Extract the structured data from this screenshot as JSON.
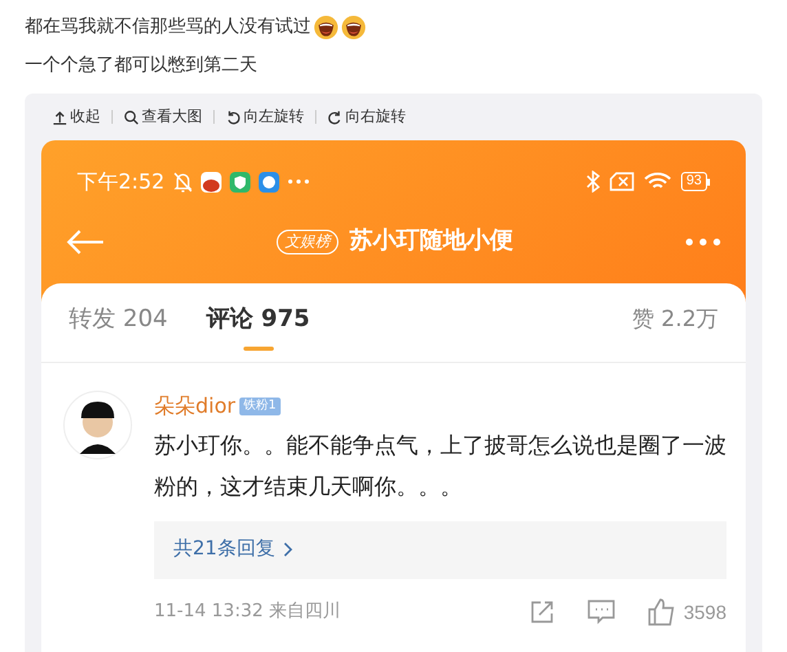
{
  "post": {
    "lines": [
      {
        "text": "都在骂我就不信那些骂的人没有试过",
        "emojis": [
          {
            "kind": "laugh"
          },
          {
            "kind": "laugh"
          }
        ]
      },
      {
        "text": "一个个急了都可以憋到第二天"
      }
    ]
  },
  "image_toolbar": [
    {
      "kind": "collapse",
      "label": "收起"
    },
    {
      "kind": "zoom",
      "label": "查看大图"
    },
    {
      "kind": "rotate_left",
      "label": "向左旋转"
    },
    {
      "kind": "rotate_right",
      "label": "向右旋转"
    }
  ],
  "phone": {
    "status_bar": {
      "time": "下午2:52",
      "battery": "93"
    },
    "header": {
      "tag": "文娱榜",
      "title": "苏小玎随地小便"
    },
    "tabs": [
      {
        "label": "转发 204",
        "selected": false
      },
      {
        "label": "评论 975",
        "selected": true
      }
    ],
    "likes": "赞 2.2万",
    "comment": {
      "user": "朵朵dior",
      "fan_badge": "铁粉1",
      "text": "苏小玎你。。能不能争点气，上了披哥怎么说也是圈了一波粉的，这才结束几天啊你。。。",
      "replies": "共21条回复",
      "meta": "11-14 13:32 来自四川",
      "like_count": "3598"
    }
  }
}
